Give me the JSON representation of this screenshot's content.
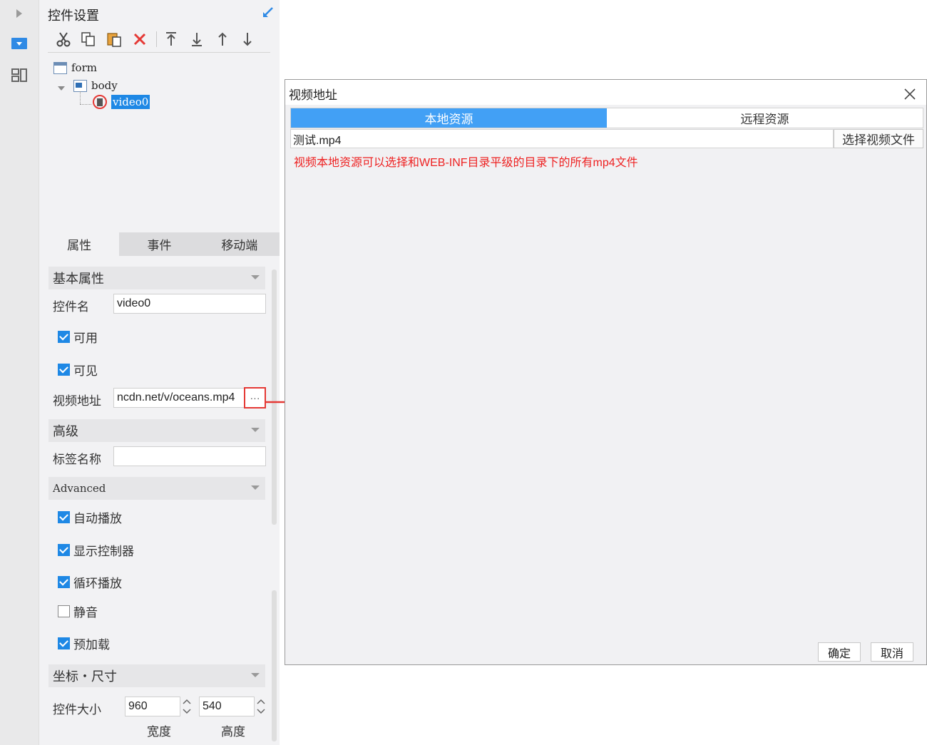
{
  "rail": {
    "items": [
      "play-icon",
      "component-icon",
      "layout-icon"
    ]
  },
  "panel": {
    "title": "控件设置",
    "toolbar": [
      "scissors-icon",
      "copy-icon",
      "paste-icon",
      "delete-icon",
      "move-top-icon",
      "move-bottom-icon",
      "move-up-icon",
      "move-down-icon"
    ],
    "tree": {
      "root": "form",
      "body": "body",
      "selected": "video0"
    },
    "tabs": [
      "属性",
      "事件",
      "移动端"
    ],
    "sections": {
      "basic": "基本属性",
      "advanced_cn": "高级",
      "advanced_en": "Advanced",
      "position": "坐标・尺寸"
    },
    "fields": {
      "name_label": "控件名",
      "name_value": "video0",
      "enabled": "可用",
      "visible": "可见",
      "video_url_label": "视频地址",
      "video_url_value": "ncdn.net/v/oceans.mp4",
      "more_button": "···",
      "tag_label": "标签名称",
      "tag_value": "",
      "autoplay": "自动播放",
      "show_controls": "显示控制器",
      "loop": "循环播放",
      "mute": "静音",
      "preload": "预加载",
      "size_label": "控件大小",
      "width_value": "960",
      "height_value": "540",
      "width_caption": "宽度",
      "height_caption": "高度"
    },
    "checked": {
      "enabled": true,
      "visible": true,
      "autoplay": true,
      "show_controls": true,
      "loop": true,
      "mute": false,
      "preload": true
    }
  },
  "dialog": {
    "title": "视频地址",
    "tabs": [
      "本地资源",
      "远程资源"
    ],
    "file_value": "测试.mp4",
    "choose_button": "选择视频文件",
    "hint": "视频本地资源可以选择和WEB-INF目录平级的目录下的所有mp4文件",
    "ok": "确定",
    "cancel": "取消"
  },
  "colors": {
    "accent": "#42a0f5",
    "checkbox": "#1e88e5",
    "hint": "#ee2222",
    "callout": "#e53935"
  }
}
